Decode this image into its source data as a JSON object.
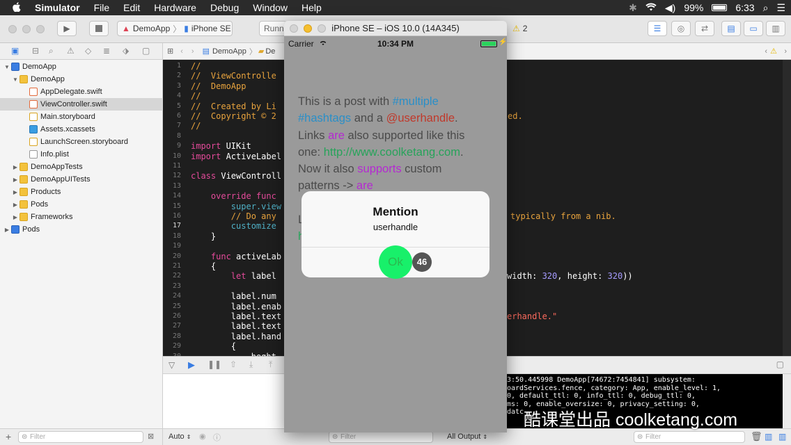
{
  "menubar": {
    "apple": "",
    "app": "Simulator",
    "items": [
      "File",
      "Edit",
      "Hardware",
      "Debug",
      "Window",
      "Help"
    ],
    "battery": "99%",
    "time": "6:33"
  },
  "toolbar": {
    "scheme": "DemoApp",
    "device": "iPhone SE",
    "status": "Runni",
    "warnings": "2"
  },
  "pathbar": {
    "project": "DemoApp",
    "folder": "De"
  },
  "navigator": {
    "items": [
      {
        "label": "DemoApp",
        "type": "proj"
      },
      {
        "label": "DemoApp",
        "type": "folder"
      },
      {
        "label": "AppDelegate.swift",
        "type": "swift"
      },
      {
        "label": "ViewController.swift",
        "type": "swift"
      },
      {
        "label": "Main.storyboard",
        "type": "sb"
      },
      {
        "label": "Assets.xcassets",
        "type": "assets"
      },
      {
        "label": "LaunchScreen.storyboard",
        "type": "sb"
      },
      {
        "label": "Info.plist",
        "type": "plist"
      },
      {
        "label": "DemoAppTests",
        "type": "folder"
      },
      {
        "label": "DemoAppUITests",
        "type": "folder"
      },
      {
        "label": "Products",
        "type": "folder"
      },
      {
        "label": "Pods",
        "type": "folder"
      },
      {
        "label": "Frameworks",
        "type": "folder"
      },
      {
        "label": "Pods",
        "type": "proj"
      }
    ],
    "filter_placeholder": "Filter"
  },
  "editor": {
    "line_numbers": [
      "1",
      "2",
      "3",
      "4",
      "5",
      "6",
      "7",
      "8",
      "9",
      "10",
      "11",
      "12",
      "13",
      "14",
      "15",
      "16",
      "17",
      "18",
      "19",
      "20",
      "21",
      "22",
      "23",
      "24",
      "25",
      "26",
      "27",
      "28",
      "29",
      "30"
    ],
    "lines": {
      "l1": "//",
      "l2": "//  ViewControlle",
      "l3": "//  DemoApp",
      "l4": "//",
      "l5": "//  Created by Li",
      "l5b": "ed.",
      "l6": "//  Copyright © 2",
      "l7": "//",
      "l9_kw": "import",
      "l9_ty": " UIKit",
      "l10_kw": "import",
      "l10_ty": " ActiveLabel",
      "l12_kw": "class",
      "l12_ty": " ViewControll",
      "l14_kw": "    override func",
      "l15_fn": "        super.view",
      "l16_cm": "        // Do any",
      "l16b_cm": "typically from a nib.",
      "l17_fn": "        customize",
      "l18": "    }",
      "l20_kw": "    func",
      "l20_ty": " activeLab",
      "l21": "    {",
      "l22_kw": "        let",
      "l22_ty": " label",
      "l22b_a": "width: ",
      "l22b_n1": "320",
      "l22b_b": ", height: ",
      "l22b_n2": "320",
      "l22b_c": "))",
      "l24": "        label.num",
      "l25": "        label.enab",
      "l26": "        label.text",
      "l26b_str": "erhandle.\"",
      "l27": "        label.text",
      "l28": "        label.hand",
      "l29": "        {",
      "l30": "            heght"
    }
  },
  "debug": {
    "auto_label": "Auto",
    "filter_placeholder": "Filter",
    "output_label": "All Output",
    "console_filter_placeholder": "Filter",
    "console_lines": [
      "3:50.445998 DemoApp[74672:7454841] subsystem:",
      "oardServices.fence, category: App, enable_level: 1,",
      "0, default_ttl: 0, info_ttl: 0, debug_ttl: 0,",
      "ms: 0, enable_oversize: 0, privacy_setting: 0,",
      "datc"
    ]
  },
  "simulator": {
    "title": "iPhone SE – iOS 10.0 (14A345)",
    "carrier": "Carrier",
    "time": "10:34 PM",
    "text": {
      "t1": "This is a post with ",
      "t2": "#multiple",
      "t3": "#hashtags",
      "t4": " and a ",
      "t5": "@userhandle",
      "t6": ".",
      "t7": "Links ",
      "t8": "are",
      "t9": " also supported like this",
      "t10": "one: ",
      "t11": "http://www.coolketang.com",
      "t12": ".",
      "t13": "Now it also ",
      "t14": "supports",
      "t15": " custom",
      "t16": "patterns -> ",
      "t17": "are",
      "t18": "L",
      "t19": "h"
    },
    "alert": {
      "title": "Mention",
      "message": "userhandle",
      "ok": "Ok"
    },
    "badge": "46"
  },
  "watermark": "酷课堂出品 coolketang.com",
  "colors": {
    "accent_green": "#18f06a",
    "hashtag": "#2a8fc8",
    "mention": "#c0392b",
    "url": "#27a35a",
    "custom": "#b42ad1"
  }
}
